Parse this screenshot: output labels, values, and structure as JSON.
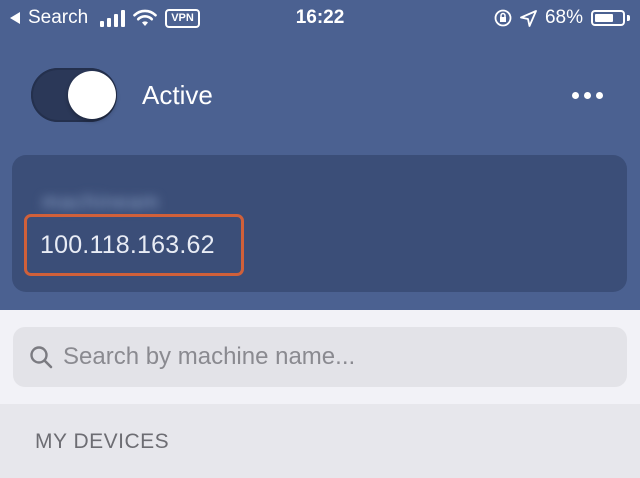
{
  "status_bar": {
    "back_label": "Search",
    "vpn_label": "VPN",
    "time": "16:22",
    "battery": "68%",
    "battery_level": 0.68,
    "icons": [
      "back-arrow-icon",
      "signal-icon",
      "wifi-icon",
      "vpn-icon",
      "orientation-lock-icon",
      "location-icon",
      "battery-icon"
    ]
  },
  "header": {
    "toggle_on": true,
    "status_label": "Active",
    "more_icon": "more-icon"
  },
  "device_card": {
    "machine_name": "machineam",
    "ip_address": "100.118.163.62",
    "highlight_color": "#d0603a"
  },
  "search": {
    "placeholder": "Search by machine name..."
  },
  "section": {
    "label": "MY DEVICES"
  },
  "colors": {
    "header_bg": "#4b6191",
    "card_bg": "#3b4e78",
    "toggle_bg": "#2b3858",
    "page_bg": "#f2f2f7"
  }
}
